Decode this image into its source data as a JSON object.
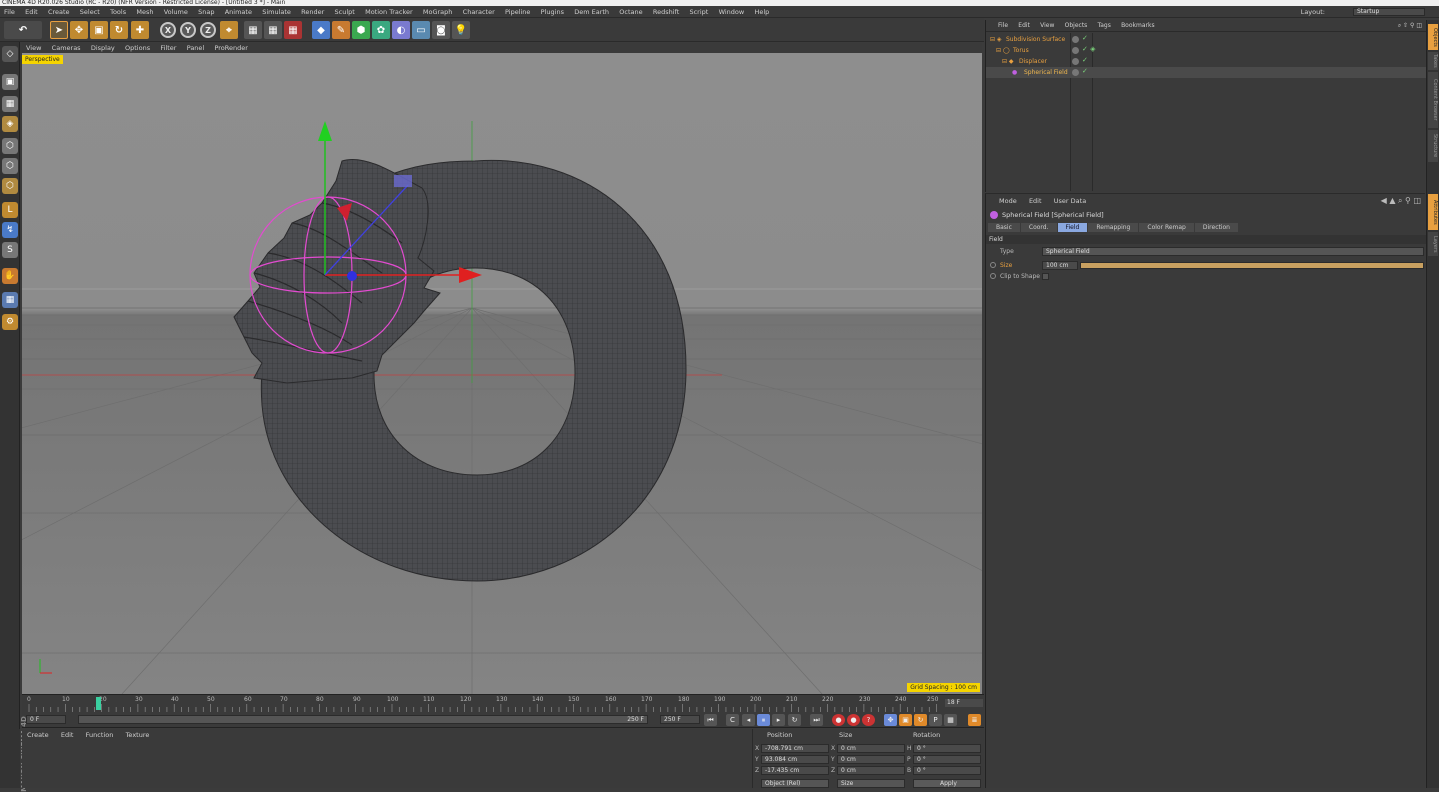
{
  "titlebar": {
    "text": "CINEMA 4D R20.026 Studio (RC - R20) (NFR Version - Restricted License) - [Untitled 3 *] - Main"
  },
  "menubar": {
    "items": [
      "File",
      "Edit",
      "Create",
      "Select",
      "Tools",
      "Mesh",
      "Volume",
      "Snap",
      "Animate",
      "Simulate",
      "Render",
      "Sculpt",
      "Motion Tracker",
      "MoGraph",
      "Character",
      "Pipeline",
      "Plugins",
      "Dem Earth",
      "Octane",
      "Redshift",
      "Script",
      "Window",
      "Help"
    ],
    "layout_label": "Layout:",
    "layout_value": "Startup"
  },
  "toolbar": {
    "axis_buttons": [
      "X",
      "Y",
      "Z"
    ]
  },
  "viewport": {
    "menu": [
      "View",
      "Cameras",
      "Display",
      "Options",
      "Filter",
      "Panel",
      "ProRender"
    ],
    "camera_label": "Perspective",
    "grid_spacing": "Grid Spacing : 100 cm",
    "colors": {
      "background": "#8a8a8a",
      "floor": "#7f7f7f",
      "mesh": "#4a4a4e",
      "gizmo_pink": "#e24bd0",
      "x_axis": "#e02020",
      "y_axis": "#20c020",
      "z_axis": "#2020e0"
    }
  },
  "timeline": {
    "ticks": [
      "0",
      "10",
      "20",
      "30",
      "40",
      "50",
      "60",
      "70",
      "80",
      "90",
      "100",
      "110",
      "120",
      "130",
      "140",
      "150",
      "160",
      "170",
      "180",
      "190",
      "200",
      "210",
      "220",
      "230",
      "240",
      "250"
    ],
    "current_frame_indicator": "18 F",
    "start_field": "0 F",
    "end_field": "250 F",
    "end_field2": "250 F"
  },
  "material_manager": {
    "menu": [
      "Create",
      "Edit",
      "Function",
      "Texture"
    ]
  },
  "coordinates": {
    "headers": [
      "Position",
      "Size",
      "Rotation"
    ],
    "rows": [
      {
        "axis": "X",
        "position": "-708.791 cm",
        "size_axis": "X",
        "size": "0 cm",
        "rot_axis": "H",
        "rotation": "0 °"
      },
      {
        "axis": "Y",
        "position": "93.084 cm",
        "size_axis": "Y",
        "size": "0 cm",
        "rot_axis": "P",
        "rotation": "0 °"
      },
      {
        "axis": "Z",
        "position": "-17.435 cm",
        "size_axis": "Z",
        "size": "0 cm",
        "rot_axis": "B",
        "rotation": "0 °"
      }
    ],
    "mode_select": "Object (Rel)",
    "size_select": "Size",
    "apply_label": "Apply"
  },
  "object_manager": {
    "menu": [
      "File",
      "Edit",
      "View",
      "Objects",
      "Tags",
      "Bookmarks"
    ],
    "objects": [
      {
        "name": "Subdivision Surface",
        "indent": 0
      },
      {
        "name": "Torus",
        "indent": 1
      },
      {
        "name": "Displacer",
        "indent": 2
      },
      {
        "name": "Spherical Field",
        "indent": 3
      }
    ]
  },
  "attributes": {
    "menu": [
      "Mode",
      "Edit",
      "User Data"
    ],
    "title": "Spherical Field [Spherical Field]",
    "tabs": [
      {
        "label": "Basic",
        "active": false
      },
      {
        "label": "Coord.",
        "active": false
      },
      {
        "label": "Field",
        "active": true
      },
      {
        "label": "Remapping",
        "active": false
      },
      {
        "label": "Color Remap",
        "active": false
      },
      {
        "label": "Direction",
        "active": false
      }
    ],
    "section": "Field",
    "type_label": "Type",
    "type_value": "Spherical Field",
    "size_label": "Size",
    "size_value": "100 cm",
    "clip_label": "Clip to Shape"
  },
  "right_strip": {
    "tabs": [
      "Objects",
      "Takes",
      "Content Browser",
      "Structure",
      "Attributes",
      "Layers"
    ]
  },
  "brand": {
    "text": "MAXON CINEMA 4D"
  }
}
